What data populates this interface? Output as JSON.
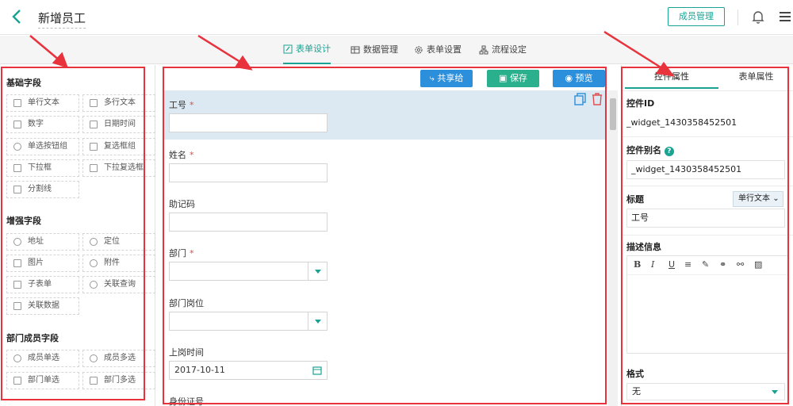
{
  "header": {
    "title": "新增员工",
    "member_button": "成员管理"
  },
  "tabs": [
    {
      "label": "表单设计",
      "icon": "edit-icon"
    },
    {
      "label": "数据管理",
      "icon": "table-icon"
    },
    {
      "label": "表单设置",
      "icon": "gear-icon"
    },
    {
      "label": "流程设定",
      "icon": "flow-icon"
    }
  ],
  "palette": {
    "groups": [
      {
        "title": "基础字段",
        "fields": [
          "单行文本",
          "多行文本",
          "数字",
          "日期时间",
          "单选按钮组",
          "复选框组",
          "下拉框",
          "下拉复选框",
          "分割线"
        ]
      },
      {
        "title": "增强字段",
        "fields": [
          "地址",
          "定位",
          "图片",
          "附件",
          "子表单",
          "关联查询",
          "关联数据"
        ]
      },
      {
        "title": "部门成员字段",
        "fields": [
          "成员单选",
          "成员多选",
          "部门单选",
          "部门多选"
        ]
      }
    ]
  },
  "toolbar": {
    "share": "共享给",
    "save": "保存",
    "preview": "预览"
  },
  "form": {
    "fields": [
      {
        "label": "工号",
        "required": "*",
        "value": ""
      },
      {
        "label": "姓名",
        "required": "*",
        "value": ""
      },
      {
        "label": "助记码",
        "required": "",
        "value": ""
      },
      {
        "label": "部门",
        "required": "*",
        "value": ""
      },
      {
        "label": "部门岗位",
        "required": "",
        "value": ""
      },
      {
        "label": "上岗时间",
        "required": "",
        "value": "2017-10-11"
      },
      {
        "label": "身份证号",
        "required": "",
        "value": ""
      }
    ]
  },
  "props": {
    "tab_widget": "控件属性",
    "tab_form": "表单属性",
    "widget_id_title": "控件ID",
    "widget_id_value": "_widget_1430358452501",
    "alias_title": "控件别名",
    "alias_value": "_widget_1430358452501",
    "caption_title": "标题",
    "caption_type": "单行文本",
    "caption_value": "工号",
    "desc_title": "描述信息",
    "rte_buttons": [
      "B",
      "I",
      "U"
    ],
    "format_title": "格式",
    "format_value": "无"
  },
  "colors": {
    "accent": "#1aa293",
    "blue_button": "#2b8fdc",
    "save_button": "#2bb08d",
    "annotation": "#e8323c"
  }
}
